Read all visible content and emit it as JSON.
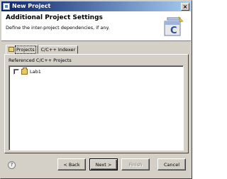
{
  "window": {
    "title": "New Project",
    "close_glyph": "×"
  },
  "banner": {
    "heading": "Additional Project Settings",
    "description": "Define the inter-project dependencies, if any.",
    "icon": "new-c-project-wizard-icon"
  },
  "tabs": [
    {
      "label": "Projects",
      "icon": "folder-icon",
      "active": true
    },
    {
      "label": "C/C++ Indexer",
      "active": false
    }
  ],
  "projects_panel": {
    "group_label": "Referenced C/C++ Projects",
    "items": [
      {
        "label": "Lab1",
        "checked": false,
        "icon": "project-folder-icon"
      }
    ]
  },
  "footer": {
    "help_glyph": "?",
    "back_label": "< Back",
    "next_label": "Next >",
    "finish_label": "Finish",
    "cancel_label": "Cancel"
  },
  "colors": {
    "title_gradient_start": "#0a246a",
    "title_gradient_end": "#a6caf0",
    "face": "#d4d0c8"
  }
}
